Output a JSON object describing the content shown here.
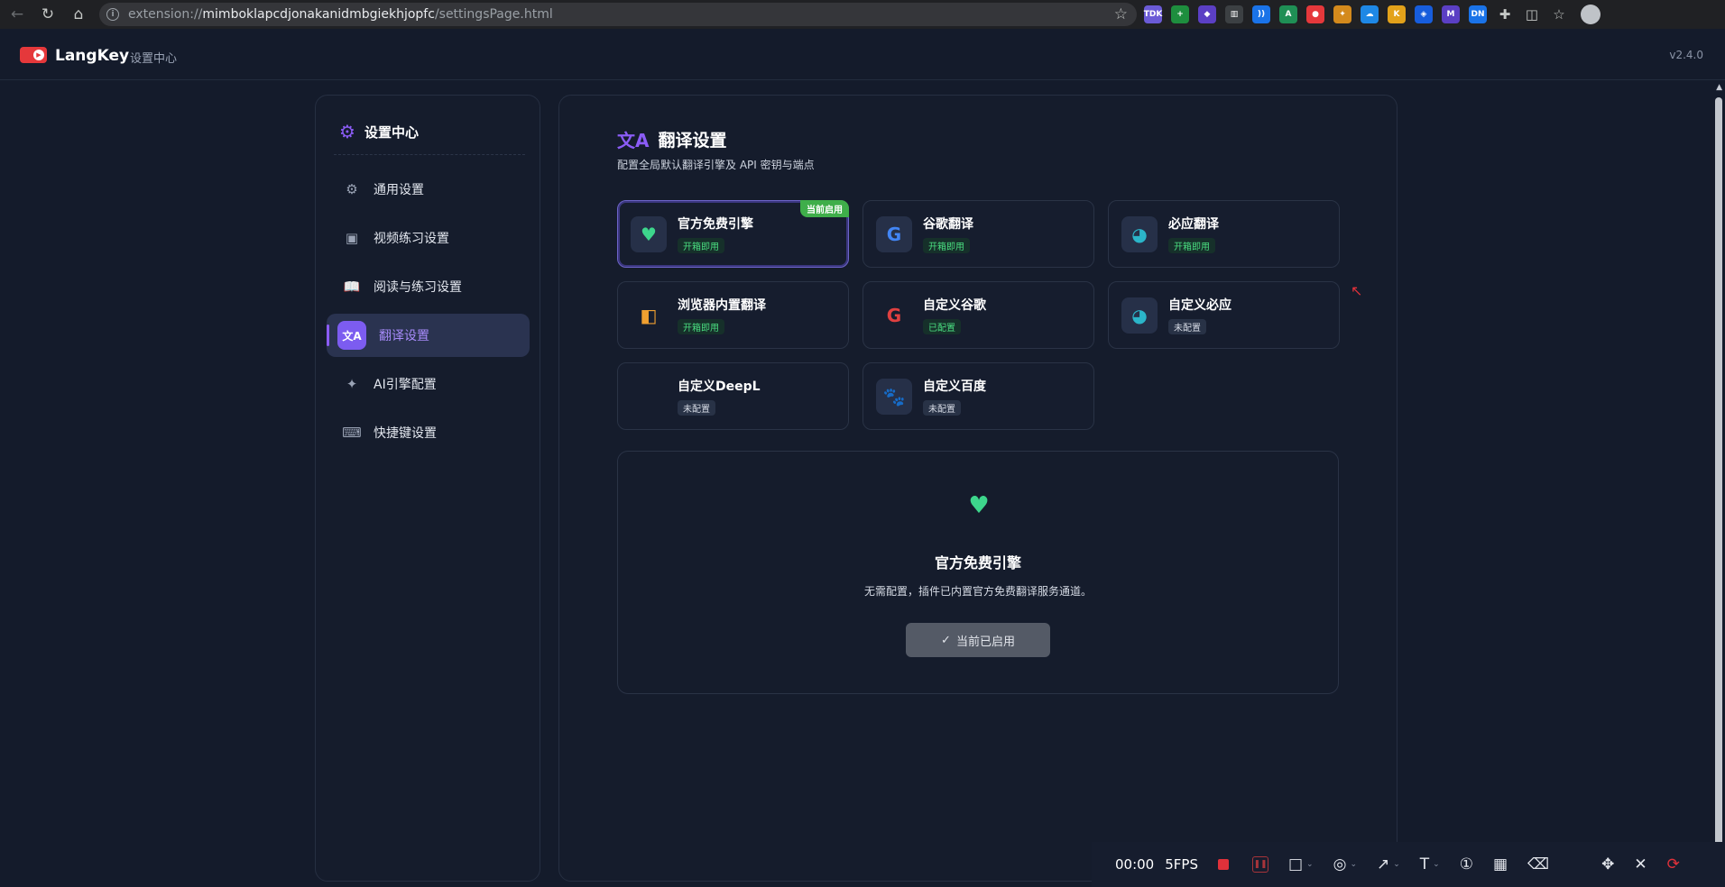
{
  "browser": {
    "url_scheme": "extension://",
    "url_host": "mimboklapcdjonakanidmbgiekhjopfc",
    "url_path": "/settingsPage.html",
    "extensions": [
      {
        "name": "tdk-ext-icon",
        "label": "TDK",
        "color": "#6b5bd6"
      },
      {
        "name": "green-ext-icon",
        "label": "+",
        "color": "#1e8e3e"
      },
      {
        "name": "diamond-ext-icon",
        "label": "◆",
        "color": "#5b3fc4"
      },
      {
        "name": "ledger-ext-icon",
        "label": "▥",
        "color": "#3c4043"
      },
      {
        "name": "wave-ext-icon",
        "label": "))",
        "color": "#1a73e8"
      },
      {
        "name": "a-ext-icon",
        "label": "A",
        "color": "#1f8f55"
      },
      {
        "name": "langkey-ext-icon",
        "label": "●",
        "color": "#e5383b"
      },
      {
        "name": "fox-ext-icon",
        "label": "✦",
        "color": "#d48a1c"
      },
      {
        "name": "cloud-ext-icon",
        "label": "☁",
        "color": "#1e88e5"
      },
      {
        "name": "circle-ext-icon",
        "label": "K",
        "color": "#e3a21a"
      },
      {
        "name": "bitwarden-ext-icon",
        "label": "◈",
        "color": "#175ddc"
      },
      {
        "name": "m-ext-icon",
        "label": "M",
        "color": "#5b3fc4"
      },
      {
        "name": "dn-ext-icon",
        "label": "DN",
        "color": "#1a73e8"
      }
    ]
  },
  "header": {
    "brand": "LangKey",
    "subtitle": "设置中心",
    "version": "v2.4.0"
  },
  "sidebar": {
    "title": "设置中心",
    "items": [
      {
        "label": "通用设置",
        "icon": "⚙"
      },
      {
        "label": "视频练习设置",
        "icon": "▣"
      },
      {
        "label": "阅读与练习设置",
        "icon": "📖"
      },
      {
        "label": "翻译设置",
        "icon": "文A"
      },
      {
        "label": "AI引擎配置",
        "icon": "✦"
      },
      {
        "label": "快捷键设置",
        "icon": "⌨"
      }
    ]
  },
  "main": {
    "title": "翻译设置",
    "description": "配置全局默认翻译引擎及 API 密钥与端点",
    "engines": [
      {
        "name": "官方免费引擎",
        "status": "开箱即用",
        "status_type": "green",
        "icon": "♥",
        "icon_color": "#3dd68c",
        "ribbon": "当前启用"
      },
      {
        "name": "谷歌翻译",
        "status": "开箱即用",
        "status_type": "green",
        "icon": "G",
        "icon_color": "#4285f4"
      },
      {
        "name": "必应翻译",
        "status": "开箱即用",
        "status_type": "green",
        "icon": "◕",
        "icon_color": "#2bb5c9"
      },
      {
        "name": "浏览器内置翻译",
        "status": "开箱即用",
        "status_type": "green",
        "icon": "◧",
        "icon_color": "#f0a030"
      },
      {
        "name": "自定义谷歌",
        "status": "已配置",
        "status_type": "green",
        "icon": "G",
        "icon_color": "#e04040"
      },
      {
        "name": "自定义必应",
        "status": "未配置",
        "status_type": "gray",
        "icon": "◕",
        "icon_color": "#2bb5c9"
      },
      {
        "name": "自定义DeepL",
        "status": "未配置",
        "status_type": "gray",
        "icon": "",
        "icon_color": "#0f2b46"
      },
      {
        "name": "自定义百度",
        "status": "未配置",
        "status_type": "gray",
        "icon": "🐾",
        "icon_color": "#2932e1"
      }
    ],
    "detail": {
      "title": "官方免费引擎",
      "description": "无需配置，插件已内置官方免费翻译服务通道。",
      "button": "当前已启用"
    }
  },
  "recorder": {
    "time": "00:00",
    "fps": "5FPS"
  }
}
